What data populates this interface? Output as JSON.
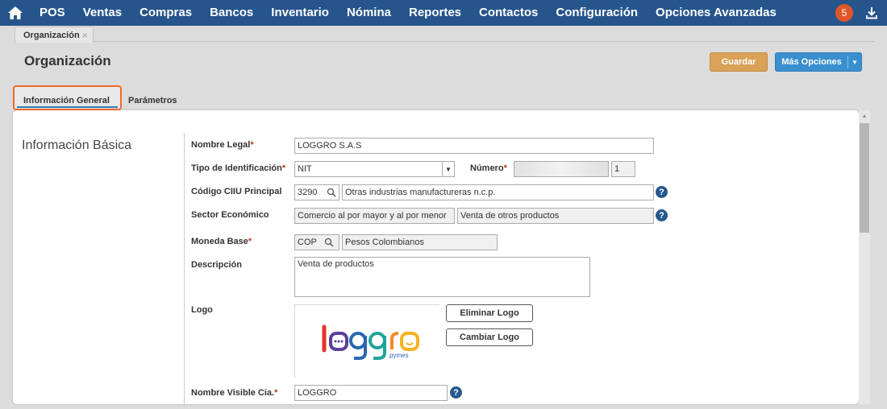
{
  "nav": {
    "items": [
      "POS",
      "Ventas",
      "Compras",
      "Bancos",
      "Inventario",
      "Nómina",
      "Reportes",
      "Contactos",
      "Configuración",
      "Opciones Avanzadas"
    ],
    "notification_count": "5",
    "icons": [
      "home-icon",
      "download-icon"
    ]
  },
  "doc_tab": {
    "label": "Organización",
    "close": "×"
  },
  "page": {
    "title": "Organización"
  },
  "toolbar": {
    "save_label": "Guardar",
    "more_label": "Más Opciones"
  },
  "tabs": {
    "general": "Información General",
    "params": "Parámetros"
  },
  "section": {
    "title": "Información Básica"
  },
  "form": {
    "legal_name": {
      "label": "Nombre Legal",
      "req": "*",
      "value": "LOGGRO S.A.S"
    },
    "id_type": {
      "label": "Tipo de Identificación",
      "req": "*",
      "value": "NIT"
    },
    "number": {
      "label": "Número",
      "req": "*",
      "value": "",
      "check_digit": "1"
    },
    "ciiu": {
      "label": "Código CIIU Principal",
      "code": "3290",
      "desc": "Otras industrias manufactureras n.c.p."
    },
    "sector": {
      "label": "Sector Económico",
      "value1": "Comercio al por mayor y al por menor",
      "value2": "Venta de otros productos"
    },
    "currency": {
      "label": "Moneda Base",
      "req": "*",
      "code": "COP",
      "desc": "Pesos Colombianos"
    },
    "description": {
      "label": "Descripción",
      "value": "Venta de productos"
    },
    "logo": {
      "label": "Logo",
      "remove_label": "Eliminar Logo",
      "change_label": "Cambiar Logo",
      "brand": "loggro",
      "brand_sub": "pymes"
    },
    "visible_name": {
      "label": "Nombre Visible Cia.",
      "req": "*",
      "value": "LOGGRO"
    }
  },
  "help_glyph": "?",
  "colors": {
    "nav_bg": "#26558c",
    "accent_orange": "#ef6c28",
    "save_btn": "#d9a257",
    "more_btn": "#3a8fcf",
    "help": "#24588e"
  }
}
